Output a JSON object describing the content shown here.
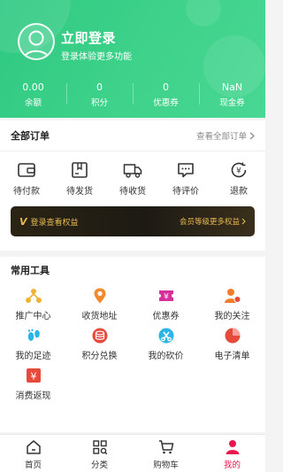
{
  "header": {
    "login_title": "立即登录",
    "login_subtitle": "登录体验更多功能",
    "background_color": "#36cc86",
    "stats": [
      {
        "value": "0.00",
        "label": "余额"
      },
      {
        "value": "0",
        "label": "积分"
      },
      {
        "value": "0",
        "label": "优惠券"
      },
      {
        "value": "NaN",
        "label": "现金券"
      }
    ]
  },
  "orders": {
    "title": "全部订单",
    "view_all": "查看全部订单",
    "items": [
      {
        "label": "待付款",
        "icon": "wallet-icon"
      },
      {
        "label": "待发货",
        "icon": "package-icon"
      },
      {
        "label": "待收货",
        "icon": "truck-icon"
      },
      {
        "label": "待评价",
        "icon": "comment-icon"
      },
      {
        "label": "退款",
        "icon": "refund-icon"
      }
    ]
  },
  "vip_banner": {
    "left_text": "登录查看权益",
    "right_text": "会员等级更多权益",
    "accent_color": "#e8b94f"
  },
  "tools": {
    "title": "常用工具",
    "items": [
      {
        "label": "推广中心",
        "icon": "network-icon",
        "color": "#f0b232"
      },
      {
        "label": "收货地址",
        "icon": "location-icon",
        "color": "#f08a2c"
      },
      {
        "label": "优惠券",
        "icon": "coupon-icon",
        "color": "#d6309a"
      },
      {
        "label": "我的关注",
        "icon": "user-follow-icon",
        "color": "#f07c2c"
      },
      {
        "label": "我的足迹",
        "icon": "footprint-icon",
        "color": "#2bb5e6"
      },
      {
        "label": "积分兑换",
        "icon": "coin-icon",
        "color": "#e64a3b"
      },
      {
        "label": "我的砍价",
        "icon": "bargain-icon",
        "color": "#2bb5e6"
      },
      {
        "label": "电子清单",
        "icon": "pie-chart-icon",
        "color": "#e64a3b"
      },
      {
        "label": "消费返现",
        "icon": "cashback-icon",
        "color": "#e64a3b"
      }
    ]
  },
  "tabbar": {
    "active_color": "#e8174f",
    "items": [
      {
        "label": "首页",
        "icon": "home-icon"
      },
      {
        "label": "分类",
        "icon": "category-icon"
      },
      {
        "label": "购物车",
        "icon": "cart-icon"
      },
      {
        "label": "我的",
        "icon": "user-icon"
      }
    ]
  }
}
